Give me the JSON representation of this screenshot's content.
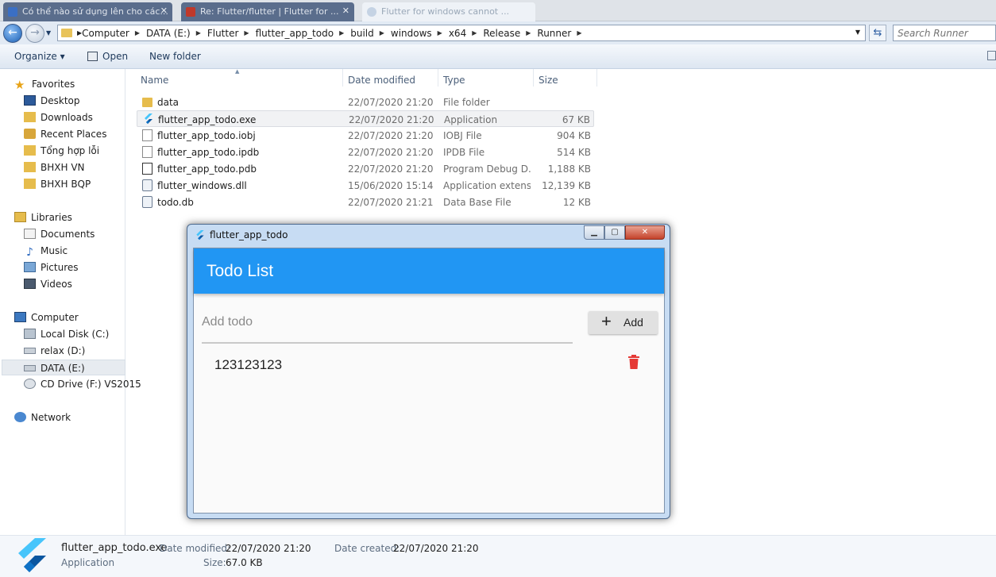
{
  "browser_tabs": [
    {
      "title": "Có thể nào sử dụng lên cho các...",
      "active": false
    },
    {
      "title": "Re: Flutter/flutter | Flutter for ...",
      "active": false
    },
    {
      "title": "Flutter for windows cannot ...",
      "active": true
    }
  ],
  "address_bar": {
    "crumbs": [
      "Computer",
      "DATA (E:)",
      "Flutter",
      "flutter_app_todo",
      "build",
      "windows",
      "x64",
      "Release",
      "Runner"
    ],
    "search_placeholder": "Search Runner"
  },
  "command_bar": {
    "organize": "Organize ▾",
    "open": "Open",
    "new_folder": "New folder"
  },
  "nav_pane": {
    "favorites": {
      "label": "Favorites",
      "items": [
        "Desktop",
        "Downloads",
        "Recent Places",
        "Tổng hợp lỗi",
        "BHXH VN",
        "BHXH BQP"
      ]
    },
    "libraries": {
      "label": "Libraries",
      "items": [
        "Documents",
        "Music",
        "Pictures",
        "Videos"
      ]
    },
    "computer": {
      "label": "Computer",
      "items": [
        "Local Disk (C:)",
        "relax (D:)",
        "DATA (E:)",
        "CD Drive (F:) VS2015"
      ],
      "selected": "DATA (E:)"
    },
    "network": {
      "label": "Network"
    }
  },
  "columns": {
    "name": "Name",
    "date": "Date modified",
    "type": "Type",
    "size": "Size"
  },
  "files": [
    {
      "name": "data",
      "date": "22/07/2020 21:20",
      "type": "File folder",
      "size": "",
      "icon": "folder-icon"
    },
    {
      "name": "flutter_app_todo.exe",
      "date": "22/07/2020 21:20",
      "type": "Application",
      "size": "67 KB",
      "icon": "flutter-icon",
      "selected": true
    },
    {
      "name": "flutter_app_todo.iobj",
      "date": "22/07/2020 21:20",
      "type": "IOBJ File",
      "size": "904 KB",
      "icon": "file-icon"
    },
    {
      "name": "flutter_app_todo.ipdb",
      "date": "22/07/2020 21:20",
      "type": "IPDB File",
      "size": "514 KB",
      "icon": "file-icon"
    },
    {
      "name": "flutter_app_todo.pdb",
      "date": "22/07/2020 21:20",
      "type": "Program Debug D...",
      "size": "1,188 KB",
      "icon": "pdb-file-icon"
    },
    {
      "name": "flutter_windows.dll",
      "date": "15/06/2020 15:14",
      "type": "Application extens...",
      "size": "12,139 KB",
      "icon": "dll-file-icon"
    },
    {
      "name": "todo.db",
      "date": "22/07/2020 21:21",
      "type": "Data Base File",
      "size": "12 KB",
      "icon": "db-file-icon"
    }
  ],
  "app_window": {
    "title": "flutter_app_todo",
    "appbar_title": "Todo List",
    "input_placeholder": "Add todo",
    "add_button": "Add",
    "todos": [
      "123123123"
    ],
    "accent_color": "#2196f3",
    "delete_color": "#e53935"
  },
  "details": {
    "file_name": "flutter_app_todo.exe",
    "file_type": "Application",
    "date_modified_label": "Date modified:",
    "date_modified": "22/07/2020 21:20",
    "date_created_label": "Date created:",
    "date_created": "22/07/2020 21:20",
    "size_label": "Size:",
    "size": "67.0 KB"
  }
}
